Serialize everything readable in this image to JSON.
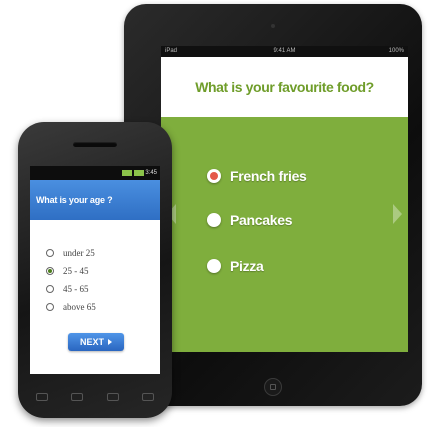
{
  "tablet": {
    "status_left": "iPad",
    "status_center": "9:41 AM",
    "status_right": "100%",
    "question": "What is your favourite food?",
    "options": [
      {
        "label": "French fries",
        "selected": true
      },
      {
        "label": "Pancakes",
        "selected": false
      },
      {
        "label": "Pizza",
        "selected": false
      }
    ],
    "background_color": "#7fae3d",
    "accent_color": "#e45a4a"
  },
  "phone": {
    "status_time": "3:45",
    "question": "What is your age ?",
    "options": [
      {
        "label": "under 25",
        "selected": false
      },
      {
        "label": "25 - 45",
        "selected": true
      },
      {
        "label": "45 - 65",
        "selected": false
      },
      {
        "label": "above 65",
        "selected": false
      }
    ],
    "next_label": "NEXT",
    "header_color": "#2f6fc4",
    "nav_keys": [
      "back-icon",
      "menu-icon",
      "home-icon",
      "search-icon"
    ]
  }
}
